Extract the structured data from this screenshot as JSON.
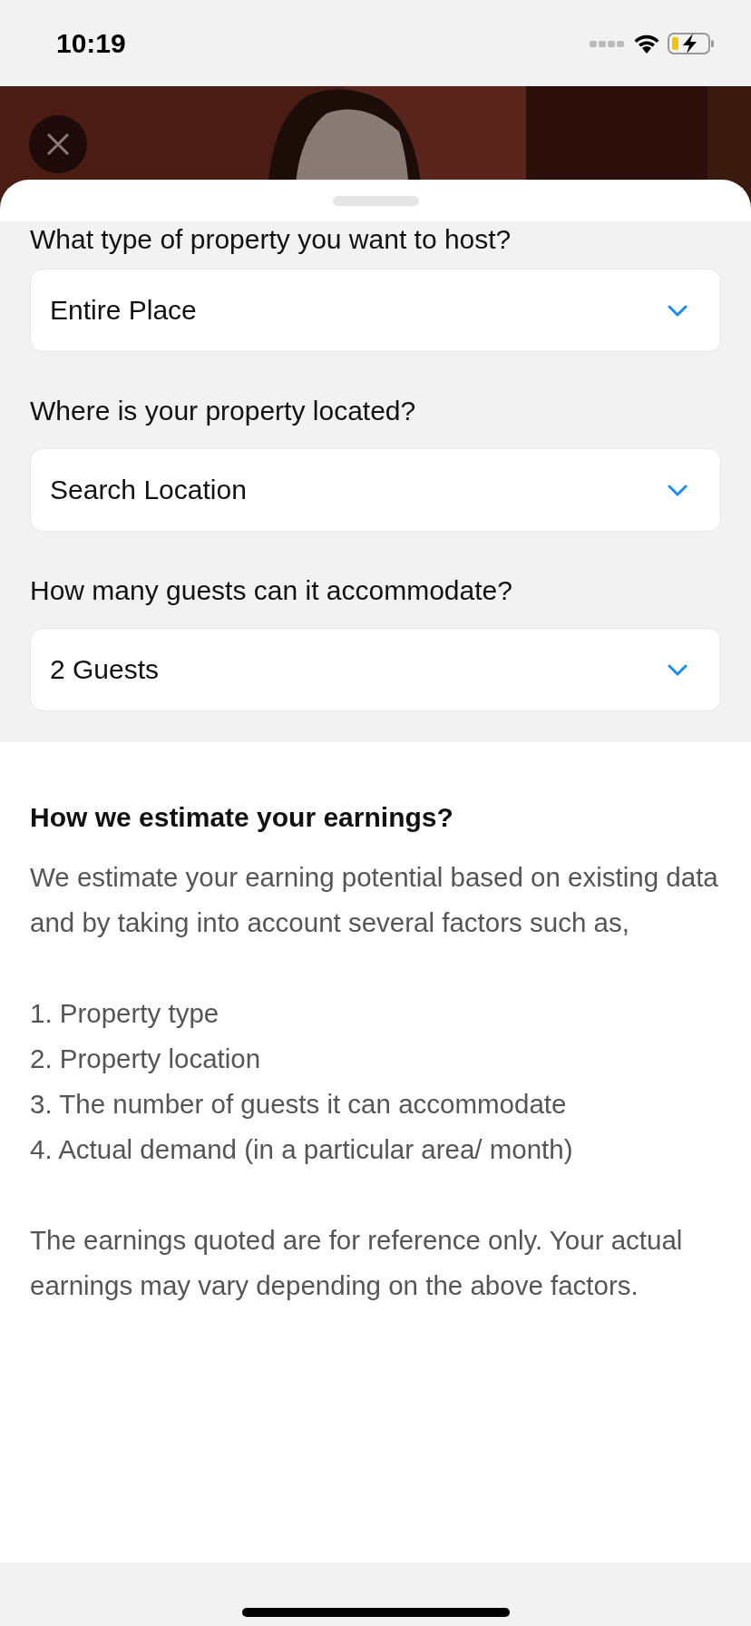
{
  "status_bar": {
    "time": "10:19"
  },
  "sheet": {
    "cut_question": "What type of property you want to host?",
    "fields": [
      {
        "value": "Entire Place"
      },
      {
        "label": "Where is your property located?",
        "value": "Search Location"
      },
      {
        "label": "How many guests can it accommodate?",
        "value": "2 Guests"
      }
    ]
  },
  "info": {
    "heading": "How we estimate your earnings?",
    "intro": "We estimate your earning potential based on existing data and by taking into account several factors such as,",
    "factors": [
      "1. Property type",
      "2. Property location",
      "3. The number of guests it can accommodate",
      "4. Actual demand (in a particular area/ month)"
    ],
    "note": "The earnings quoted are for reference only. Your actual earnings may vary depending on the above factors."
  }
}
